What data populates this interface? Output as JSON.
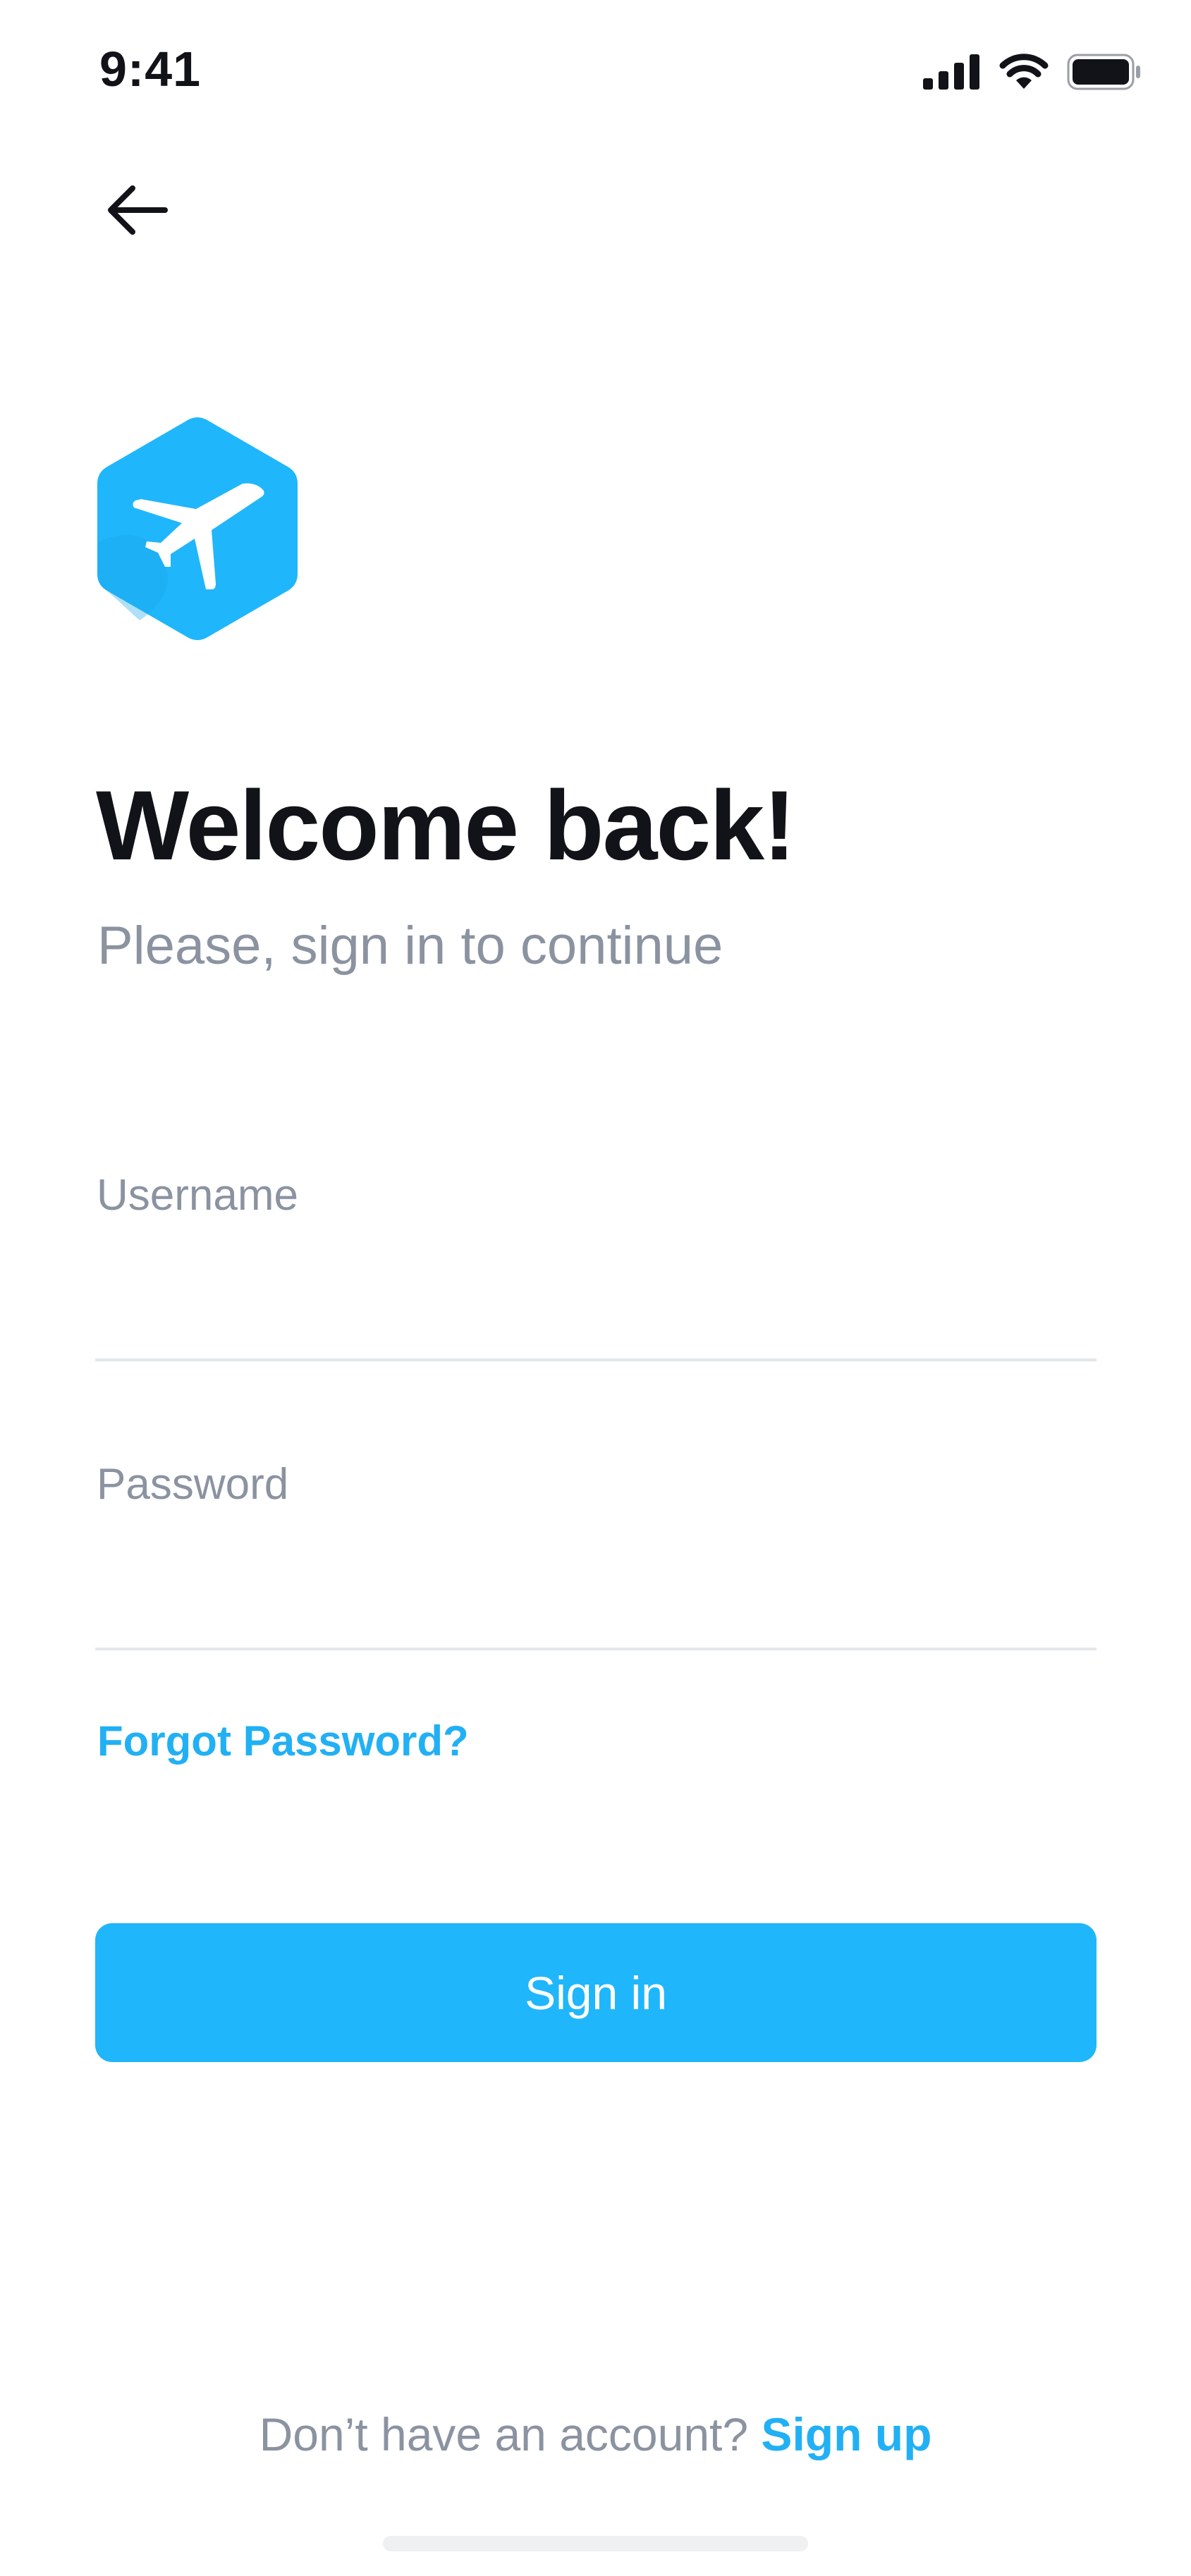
{
  "status_bar": {
    "time": "9:41"
  },
  "header": {
    "back_icon": "arrow-left-icon"
  },
  "brand": {
    "logo_icon": "airplane-hexagon-icon",
    "accent_color": "#20b6fb"
  },
  "login": {
    "title": "Welcome back!",
    "subtitle": "Please, sign in to continue",
    "username_label": "Username",
    "username_value": "",
    "password_label": "Password",
    "password_value": "",
    "forgot_password": "Forgot Password?",
    "sign_in": "Sign in"
  },
  "footer": {
    "prompt": "Don’t have an account?",
    "sign_up": "Sign up"
  }
}
